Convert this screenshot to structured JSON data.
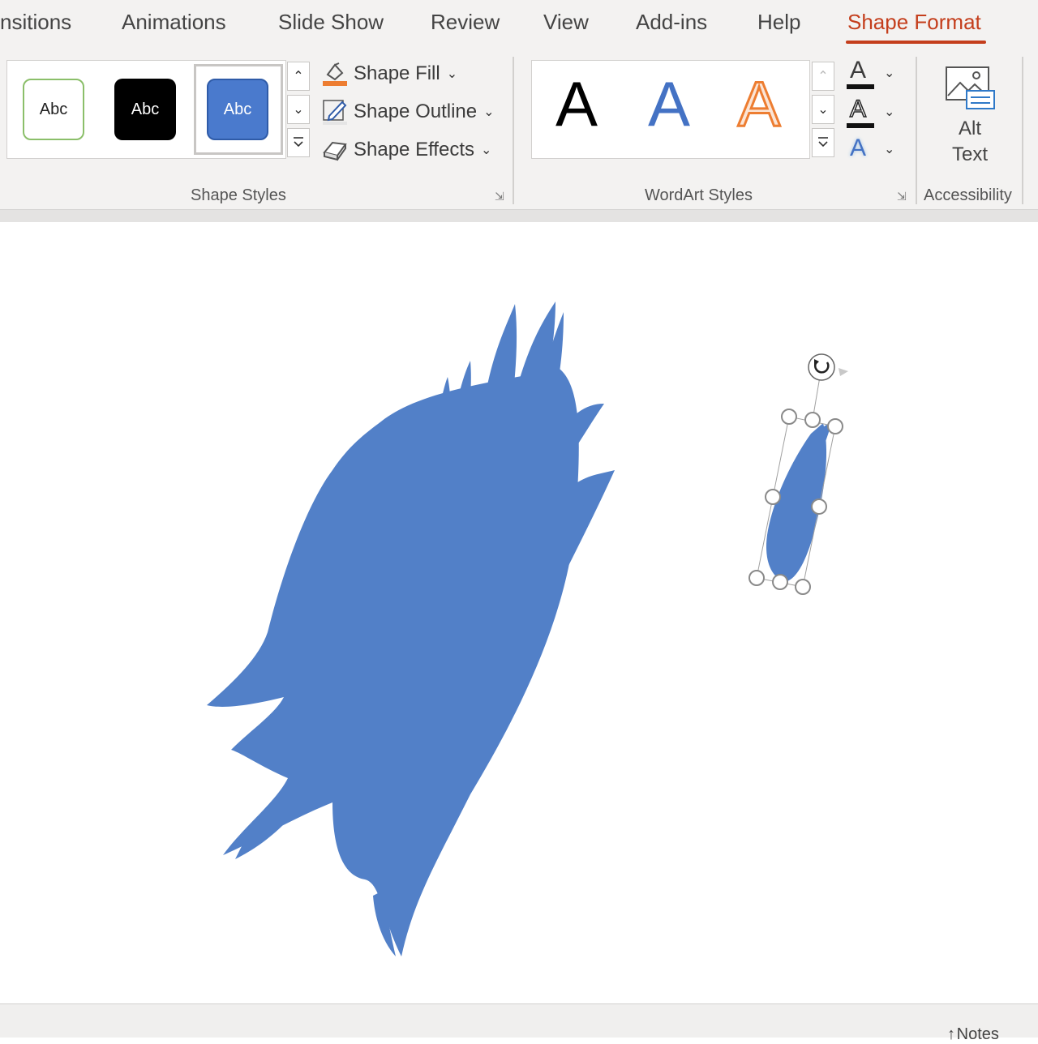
{
  "tabs": {
    "transitions": "nsitions",
    "animations": "Animations",
    "slide_show": "Slide Show",
    "review": "Review",
    "view": "View",
    "addins": "Add-ins",
    "help": "Help",
    "shape_format": "Shape Format"
  },
  "shape_styles": {
    "swatches": [
      "Abc",
      "Abc",
      "Abc"
    ],
    "shape_fill": "Shape Fill",
    "shape_outline": "Shape Outline",
    "shape_effects": "Shape Effects",
    "group_label": "Shape Styles"
  },
  "wordart": {
    "letters": [
      "A",
      "A",
      "A"
    ],
    "group_label": "WordArt Styles",
    "text_effect_letter": "A"
  },
  "accessibility": {
    "alt_text_line1": "Alt",
    "alt_text_line2": "Text",
    "group_label": "Accessibility"
  },
  "status": {
    "notes": "Notes"
  },
  "colors": {
    "accent_tab": "#c43e1c",
    "shape_fill": "#5280c8",
    "wordart_blue": "#4472c4",
    "wordart_orange": "#ed7d31"
  }
}
